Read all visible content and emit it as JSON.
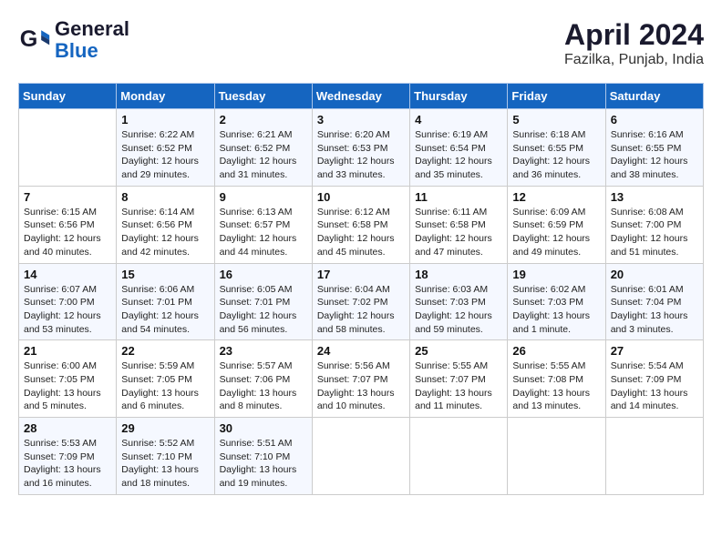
{
  "header": {
    "logo_line1": "General",
    "logo_line2": "Blue",
    "month": "April 2024",
    "location": "Fazilka, Punjab, India"
  },
  "weekdays": [
    "Sunday",
    "Monday",
    "Tuesday",
    "Wednesday",
    "Thursday",
    "Friday",
    "Saturday"
  ],
  "weeks": [
    [
      {
        "num": "",
        "info": ""
      },
      {
        "num": "1",
        "info": "Sunrise: 6:22 AM\nSunset: 6:52 PM\nDaylight: 12 hours\nand 29 minutes."
      },
      {
        "num": "2",
        "info": "Sunrise: 6:21 AM\nSunset: 6:52 PM\nDaylight: 12 hours\nand 31 minutes."
      },
      {
        "num": "3",
        "info": "Sunrise: 6:20 AM\nSunset: 6:53 PM\nDaylight: 12 hours\nand 33 minutes."
      },
      {
        "num": "4",
        "info": "Sunrise: 6:19 AM\nSunset: 6:54 PM\nDaylight: 12 hours\nand 35 minutes."
      },
      {
        "num": "5",
        "info": "Sunrise: 6:18 AM\nSunset: 6:55 PM\nDaylight: 12 hours\nand 36 minutes."
      },
      {
        "num": "6",
        "info": "Sunrise: 6:16 AM\nSunset: 6:55 PM\nDaylight: 12 hours\nand 38 minutes."
      }
    ],
    [
      {
        "num": "7",
        "info": "Sunrise: 6:15 AM\nSunset: 6:56 PM\nDaylight: 12 hours\nand 40 minutes."
      },
      {
        "num": "8",
        "info": "Sunrise: 6:14 AM\nSunset: 6:56 PM\nDaylight: 12 hours\nand 42 minutes."
      },
      {
        "num": "9",
        "info": "Sunrise: 6:13 AM\nSunset: 6:57 PM\nDaylight: 12 hours\nand 44 minutes."
      },
      {
        "num": "10",
        "info": "Sunrise: 6:12 AM\nSunset: 6:58 PM\nDaylight: 12 hours\nand 45 minutes."
      },
      {
        "num": "11",
        "info": "Sunrise: 6:11 AM\nSunset: 6:58 PM\nDaylight: 12 hours\nand 47 minutes."
      },
      {
        "num": "12",
        "info": "Sunrise: 6:09 AM\nSunset: 6:59 PM\nDaylight: 12 hours\nand 49 minutes."
      },
      {
        "num": "13",
        "info": "Sunrise: 6:08 AM\nSunset: 7:00 PM\nDaylight: 12 hours\nand 51 minutes."
      }
    ],
    [
      {
        "num": "14",
        "info": "Sunrise: 6:07 AM\nSunset: 7:00 PM\nDaylight: 12 hours\nand 53 minutes."
      },
      {
        "num": "15",
        "info": "Sunrise: 6:06 AM\nSunset: 7:01 PM\nDaylight: 12 hours\nand 54 minutes."
      },
      {
        "num": "16",
        "info": "Sunrise: 6:05 AM\nSunset: 7:01 PM\nDaylight: 12 hours\nand 56 minutes."
      },
      {
        "num": "17",
        "info": "Sunrise: 6:04 AM\nSunset: 7:02 PM\nDaylight: 12 hours\nand 58 minutes."
      },
      {
        "num": "18",
        "info": "Sunrise: 6:03 AM\nSunset: 7:03 PM\nDaylight: 12 hours\nand 59 minutes."
      },
      {
        "num": "19",
        "info": "Sunrise: 6:02 AM\nSunset: 7:03 PM\nDaylight: 13 hours\nand 1 minute."
      },
      {
        "num": "20",
        "info": "Sunrise: 6:01 AM\nSunset: 7:04 PM\nDaylight: 13 hours\nand 3 minutes."
      }
    ],
    [
      {
        "num": "21",
        "info": "Sunrise: 6:00 AM\nSunset: 7:05 PM\nDaylight: 13 hours\nand 5 minutes."
      },
      {
        "num": "22",
        "info": "Sunrise: 5:59 AM\nSunset: 7:05 PM\nDaylight: 13 hours\nand 6 minutes."
      },
      {
        "num": "23",
        "info": "Sunrise: 5:57 AM\nSunset: 7:06 PM\nDaylight: 13 hours\nand 8 minutes."
      },
      {
        "num": "24",
        "info": "Sunrise: 5:56 AM\nSunset: 7:07 PM\nDaylight: 13 hours\nand 10 minutes."
      },
      {
        "num": "25",
        "info": "Sunrise: 5:55 AM\nSunset: 7:07 PM\nDaylight: 13 hours\nand 11 minutes."
      },
      {
        "num": "26",
        "info": "Sunrise: 5:55 AM\nSunset: 7:08 PM\nDaylight: 13 hours\nand 13 minutes."
      },
      {
        "num": "27",
        "info": "Sunrise: 5:54 AM\nSunset: 7:09 PM\nDaylight: 13 hours\nand 14 minutes."
      }
    ],
    [
      {
        "num": "28",
        "info": "Sunrise: 5:53 AM\nSunset: 7:09 PM\nDaylight: 13 hours\nand 16 minutes."
      },
      {
        "num": "29",
        "info": "Sunrise: 5:52 AM\nSunset: 7:10 PM\nDaylight: 13 hours\nand 18 minutes."
      },
      {
        "num": "30",
        "info": "Sunrise: 5:51 AM\nSunset: 7:10 PM\nDaylight: 13 hours\nand 19 minutes."
      },
      {
        "num": "",
        "info": ""
      },
      {
        "num": "",
        "info": ""
      },
      {
        "num": "",
        "info": ""
      },
      {
        "num": "",
        "info": ""
      }
    ]
  ]
}
